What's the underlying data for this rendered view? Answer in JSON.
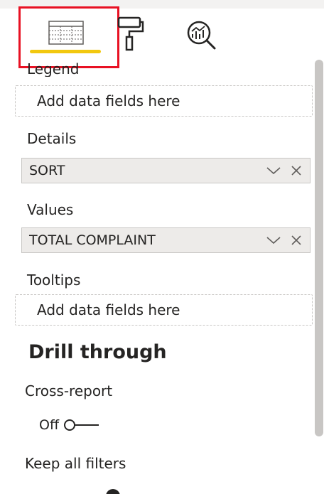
{
  "tabs": [
    {
      "id": "fields",
      "icon": "fields-grid-icon",
      "active": true
    },
    {
      "id": "format",
      "icon": "paint-roller-icon",
      "active": false
    },
    {
      "id": "analytics",
      "icon": "analytics-magnifier-icon",
      "active": false
    }
  ],
  "colors": {
    "active_tab_underline": "#f2c80f",
    "highlight_box": "#e81123",
    "pill_background": "#edebe9",
    "well_border": "#c8c6c4"
  },
  "sections": {
    "legend": {
      "label": "Legend",
      "placeholder": "Add data fields here"
    },
    "details": {
      "label": "Details",
      "field": "SORT"
    },
    "values": {
      "label": "Values",
      "field": "TOTAL COMPLAINT"
    },
    "tooltips": {
      "label": "Tooltips",
      "placeholder": "Add data fields here"
    }
  },
  "drill_through": {
    "title": "Drill through",
    "cross_report": {
      "label": "Cross-report",
      "state": "Off"
    },
    "keep_all_filters": {
      "label": "Keep all filters"
    }
  }
}
